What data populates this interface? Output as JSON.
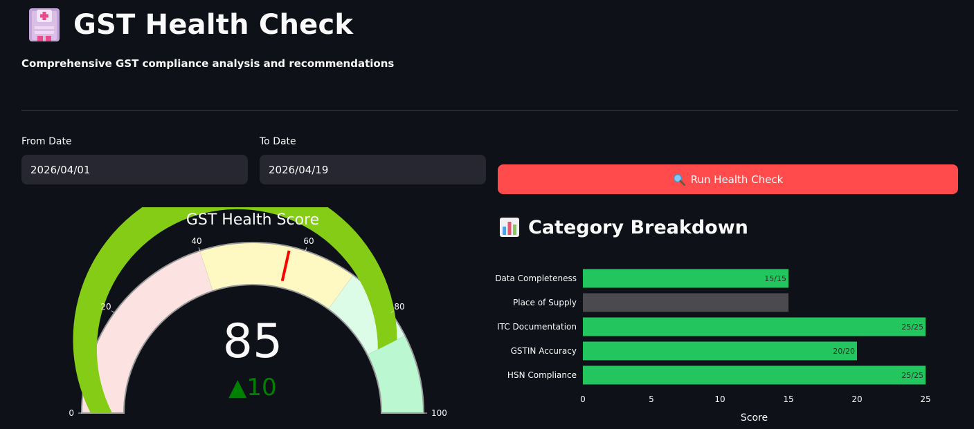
{
  "header": {
    "icon": "hospital-icon",
    "title": "GST Health Check",
    "subtitle": "Comprehensive GST compliance analysis and recommendations"
  },
  "filters": {
    "from_label": "From Date",
    "from_value": "2026/04/01",
    "to_label": "To Date",
    "to_value": "2026/04/19"
  },
  "actions": {
    "run_icon": "magnifier-icon",
    "run_label": "Run Health Check",
    "run_color": "#ff4b4b"
  },
  "section": {
    "icon": "bar-chart-icon",
    "title": "Category Breakdown"
  },
  "chart_data": [
    {
      "type": "gauge",
      "title": "GST Health Score",
      "value": 85,
      "delta": "▲10",
      "delta_color": "#008000",
      "range": [
        0,
        100
      ],
      "ticks": [
        0,
        20,
        40,
        60,
        80,
        100
      ],
      "bar_color": "#84cc16",
      "threshold": 57,
      "threshold_color": "#ff0000",
      "steps": [
        {
          "range": [
            0,
            40
          ],
          "color": "#fde2e2"
        },
        {
          "range": [
            40,
            70
          ],
          "color": "#fef9c3"
        },
        {
          "range": [
            70,
            85
          ],
          "color": "#dcfce7"
        },
        {
          "range": [
            85,
            100
          ],
          "color": "#bbf7d0"
        }
      ]
    },
    {
      "type": "bar",
      "orientation": "horizontal",
      "categories": [
        "Data Completeness",
        "Place of Supply",
        "ITC Documentation",
        "GSTIN Accuracy",
        "HSN Compliance"
      ],
      "values": [
        15,
        15,
        25,
        20,
        25
      ],
      "labels": [
        "15/15",
        "",
        "25/25",
        "20/20",
        "25/25"
      ],
      "colors": [
        "#22c55e",
        "#4b4b4f",
        "#22c55e",
        "#22c55e",
        "#22c55e"
      ],
      "xlabel": "Score",
      "xlim": [
        0,
        25
      ],
      "xticks": [
        0,
        5,
        10,
        15,
        20,
        25
      ]
    }
  ]
}
